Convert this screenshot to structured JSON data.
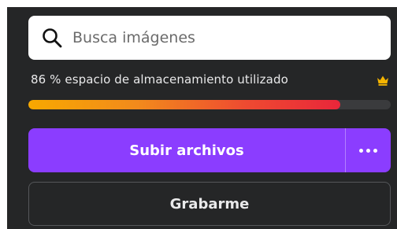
{
  "search": {
    "placeholder": "Busca imágenes",
    "icon": "search-icon"
  },
  "storage": {
    "label": "86 % espacio de almacenamiento utilizado",
    "used_percent": 86,
    "icon": "crown-icon",
    "icon_color": "#f5b400"
  },
  "actions": {
    "upload_label": "Subir archivos",
    "more_icon": "more-horizontal-icon",
    "record_label": "Grabarme"
  },
  "colors": {
    "background": "#252627",
    "accent": "#8b3dff",
    "progress_start": "#f7a800",
    "progress_end": "#e9263a"
  }
}
